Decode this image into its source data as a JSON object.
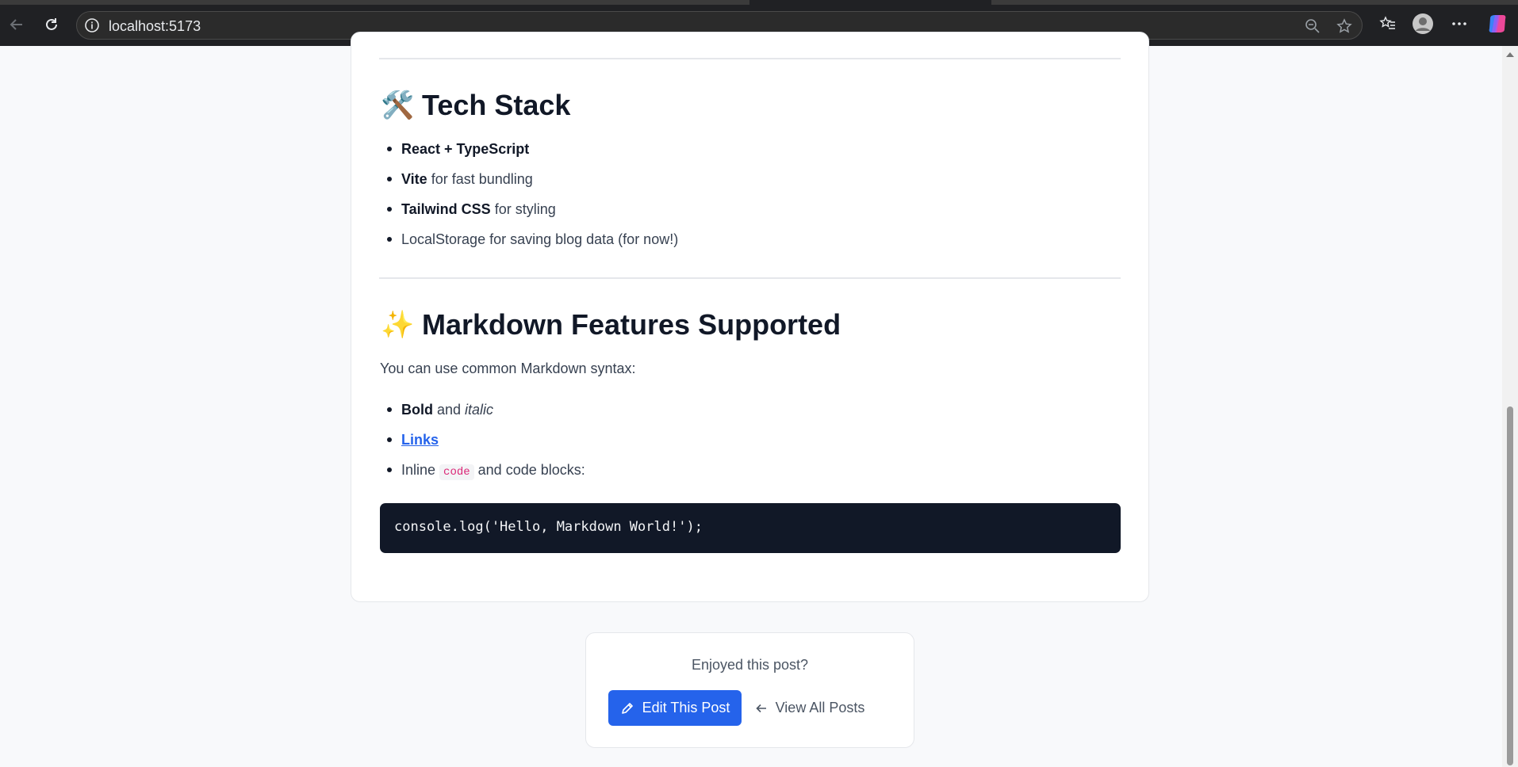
{
  "browser": {
    "url": "localhost:5173"
  },
  "tech_stack": {
    "emoji": "🛠️",
    "heading": "Tech Stack",
    "items": [
      {
        "bold": "React + TypeScript",
        "rest": ""
      },
      {
        "bold": "Vite",
        "rest": " for fast bundling"
      },
      {
        "bold": "Tailwind CSS",
        "rest": " for styling"
      },
      {
        "bold": "",
        "rest": "LocalStorage for saving blog data (for now!)"
      }
    ]
  },
  "markdown": {
    "emoji": "✨",
    "heading": "Markdown Features Supported",
    "intro": "You can use common Markdown syntax:",
    "item_bold": "Bold",
    "item_and": " and ",
    "item_italic": "italic",
    "item_link": "Links",
    "item_inline_pre": "Inline ",
    "item_inline_code": "code",
    "item_inline_post": " and code blocks:",
    "code_block": "console.log('Hello, Markdown World!');"
  },
  "footer": {
    "question": "Enjoyed this post?",
    "edit_label": "Edit This Post",
    "view_label": "View All Posts"
  },
  "colors": {
    "accent": "#2563eb",
    "heading": "#111827",
    "code_bg": "#111827",
    "inline_code": "#db2777"
  }
}
